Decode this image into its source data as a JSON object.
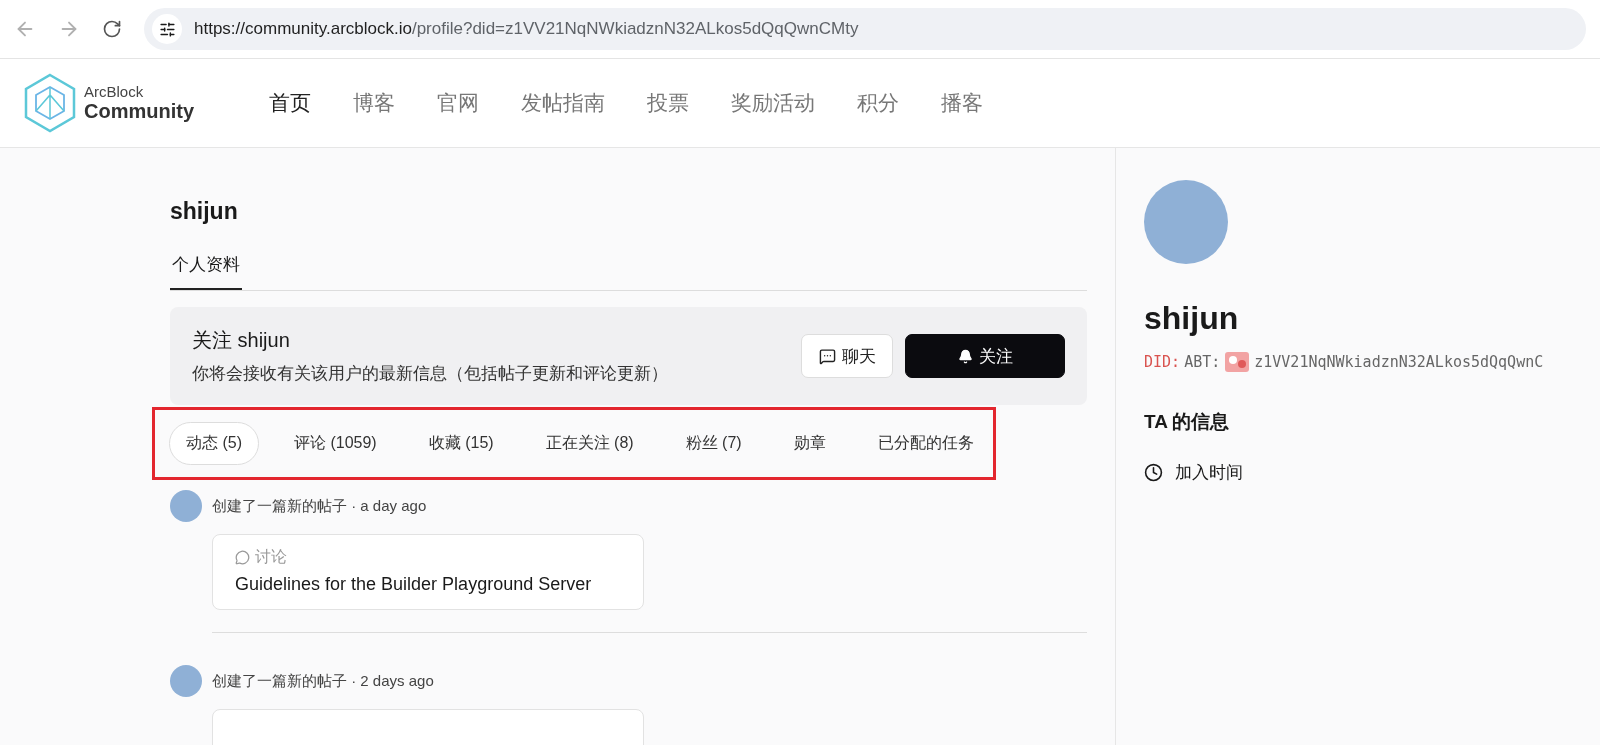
{
  "browser": {
    "url_host": "https://community.arcblock.io",
    "url_path": "/profile?did=z1VV21NqNWkiadznN32ALkos5dQqQwnCMty"
  },
  "header": {
    "logo_top": "ArcBlock",
    "logo_bottom": "Community",
    "nav": [
      {
        "label": "首页",
        "selected": true
      },
      {
        "label": "博客",
        "selected": false
      },
      {
        "label": "官网",
        "selected": false
      },
      {
        "label": "发帖指南",
        "selected": false
      },
      {
        "label": "投票",
        "selected": false
      },
      {
        "label": "奖励活动",
        "selected": false
      },
      {
        "label": "积分",
        "selected": false
      },
      {
        "label": "播客",
        "selected": false
      }
    ]
  },
  "profile": {
    "name": "shijun",
    "section_tab": "个人资料",
    "follow_card": {
      "title": "关注 shijun",
      "description": "你将会接收有关该用户的最新信息（包括帖子更新和评论更新）",
      "chat_button": "聊天",
      "follow_button": "关注"
    },
    "tabs": [
      {
        "label": "动态 (5)",
        "selected": true
      },
      {
        "label": "评论 (1059)",
        "selected": false
      },
      {
        "label": "收藏 (15)",
        "selected": false
      },
      {
        "label": "正在关注 (8)",
        "selected": false
      },
      {
        "label": "粉丝 (7)",
        "selected": false
      },
      {
        "label": "勋章",
        "selected": false
      },
      {
        "label": "已分配的任务",
        "selected": false
      }
    ],
    "activity": [
      {
        "summary": "创建了一篇新的帖子 · a day ago",
        "tag": "讨论",
        "title": "Guidelines for the Builder Playground Server"
      },
      {
        "summary": "创建了一篇新的帖子 · 2 days ago"
      }
    ]
  },
  "sidebar": {
    "name": "shijun",
    "did_prefix": "DID:",
    "did_method": "ABT:",
    "did_address": "z1VV21NqNWkiadznN32ALkos5dQqQwnC",
    "info_title": "TA 的信息",
    "info_items": [
      {
        "label": "加入时间"
      }
    ]
  }
}
